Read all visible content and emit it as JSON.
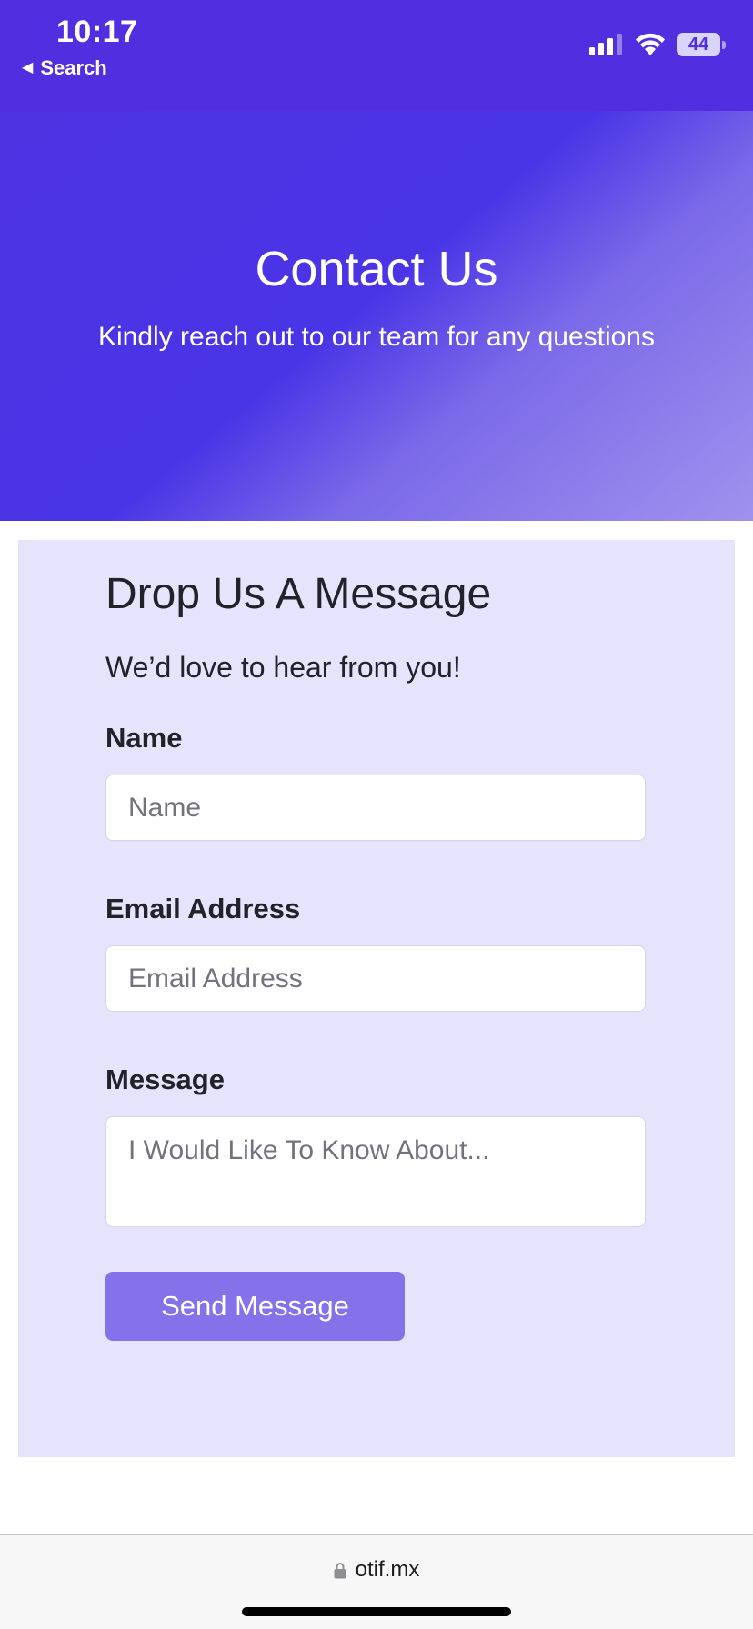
{
  "status_bar": {
    "time": "10:17",
    "back_label": "Search",
    "battery_level": "44",
    "icons": [
      "cellular-signal-icon",
      "wifi-icon",
      "battery-icon"
    ]
  },
  "hero": {
    "title": "Contact Us",
    "subtitle": "Kindly reach out to our team for any questions"
  },
  "form": {
    "heading": "Drop Us A Message",
    "intro": "We’d love to hear from you!",
    "name_label": "Name",
    "name_placeholder": "Name",
    "email_label": "Email Address",
    "email_placeholder": "Email Address",
    "message_label": "Message",
    "message_placeholder": "I Would Like To Know About...",
    "submit_label": "Send Message"
  },
  "browser": {
    "url": "otif.mx"
  },
  "colors": {
    "brand_purple": "#512ee0",
    "form_background": "#e6e3fc",
    "button_background": "#8572ea"
  }
}
